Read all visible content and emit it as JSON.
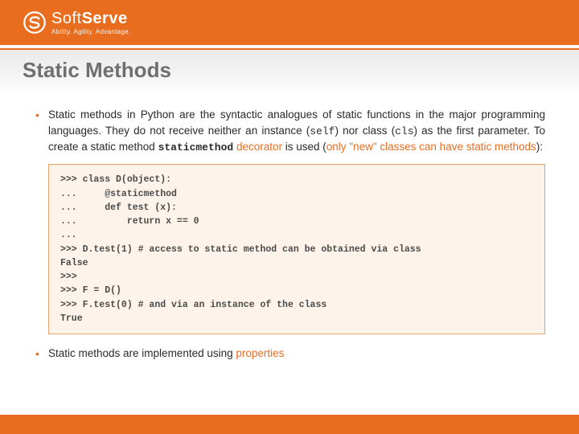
{
  "header": {
    "brand_a": "Soft",
    "brand_b": "Serve",
    "tagline": "Ability. Agility. Advantage."
  },
  "title": "Static Methods",
  "bullets": {
    "b1_pre": "Static methods in Python are the syntactic analogues of static functions in the major programming languages. They do not receive neither an instance (",
    "b1_self": "self",
    "b1_mid1": ") nor class (",
    "b1_cls": "cls",
    "b1_mid2": ") as the first parameter. To create a static method ",
    "b1_sm": "staticmethod",
    "b1_dec": " decorator",
    "b1_used": " is used (",
    "b1_note": "only \"new\" classes can have static methods",
    "b1_end": "):",
    "b2_a": "Static methods are implemented using ",
    "b2_b": "properties"
  },
  "code": ">>> class D(object):\n...     @staticmethod\n...     def test (x):\n...         return x == 0\n...\n>>> D.test(1) # access to static method can be obtained via class\nFalse\n>>>\n>>> F = D()\n>>> F.test(0) # and via an instance of the class\nTrue"
}
